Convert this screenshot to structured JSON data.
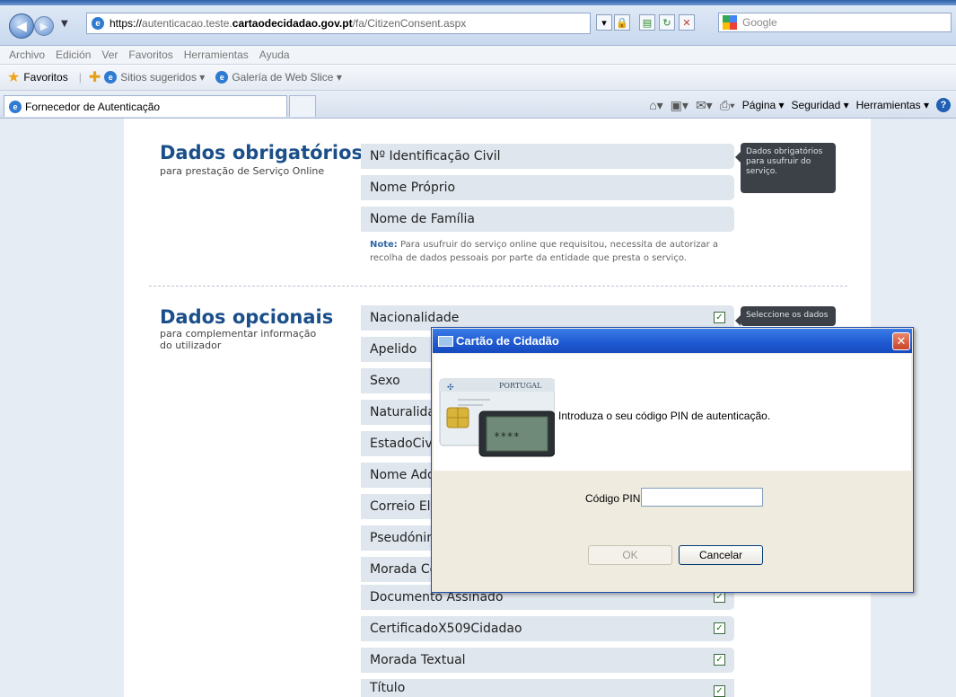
{
  "browser": {
    "url_scheme": "https://",
    "url_host": "autenticacao.teste.",
    "url_domain": "cartaodecidadao.gov.pt",
    "url_path": "/fa/CitizenConsent.aspx",
    "search_placeholder": "Google",
    "menu": [
      "Archivo",
      "Edición",
      "Ver",
      "Favoritos",
      "Herramientas",
      "Ayuda"
    ],
    "favorites_label": "Favoritos",
    "fav_links": [
      "Sitios sugeridos ▾",
      "Galería de Web Slice ▾"
    ],
    "tab_title": "Fornecedor de Autenticação",
    "commands": [
      "Página ▾",
      "Seguridad ▾",
      "Herramientas ▾"
    ]
  },
  "required": {
    "title": "Dados obrigatórios",
    "subtitle": "para prestação de Serviço Online",
    "fields": [
      "Nº Identificação Civil",
      "Nome Próprio",
      "Nome de Família"
    ],
    "tip": "Dados obrigatórios para usufruir do serviço.",
    "note_label": "Note:",
    "note_text": "Para usufruir do serviço online que requisitou, necessita de autorizar a recolha de dados pessoais por parte da entidade que presta o serviço."
  },
  "optional": {
    "title": "Dados opcionais",
    "subtitle": "para complementar informação do utilizador",
    "tip": "Seleccione os dados",
    "fields": [
      "Nacionalidade",
      "Apelido",
      "Sexo",
      "Naturalidade",
      "EstadoCivil",
      "Nome Adoptado",
      "Correio Electrónico",
      "Pseudónimo",
      "Morada Completa",
      "Documento Assinado",
      "CertificadoX509Cidadao",
      "Morada Textual",
      "Título"
    ]
  },
  "dialog": {
    "title": "Cartão de Cidadão",
    "instruction": "Introduza o seu código PIN de autenticação.",
    "pin_label": "Código PIN",
    "pin_value": "",
    "ok_label": "OK",
    "cancel_label": "Cancelar",
    "card_country": "PORTUGAL",
    "card_pin_mask": "****"
  }
}
